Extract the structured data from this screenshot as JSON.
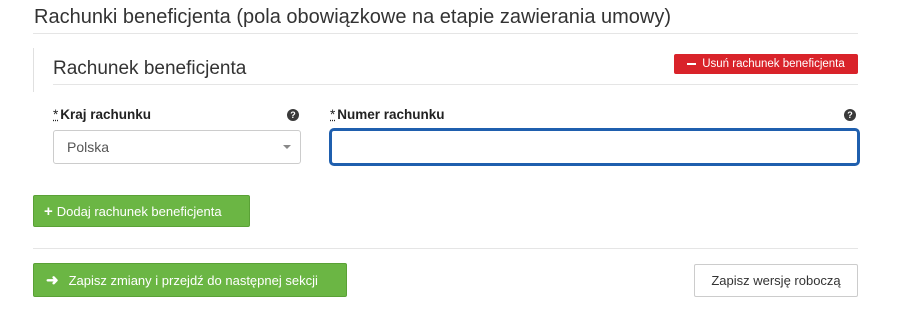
{
  "section": {
    "title": "Rachunki beneficjenta (pola obowiązkowe na etapie zawierania umowy)"
  },
  "account": {
    "title": "Rachunek beneficjenta",
    "remove_label": "Usuń rachunek beneficjenta",
    "country_label": "Kraj rachunku",
    "country_value": "Polska",
    "number_label": "Numer rachunku",
    "number_value": "",
    "required_mark": "*",
    "help_glyph": "?"
  },
  "actions": {
    "add_label": "Dodaj rachunek beneficjenta",
    "save_next_label": "Zapisz zmiany i przejdź do następnej sekcji",
    "draft_label": "Zapisz wersję roboczą"
  },
  "colors": {
    "danger": "#d9232a",
    "success": "#6bb644",
    "focus": "#1f5fae"
  },
  "icons": {
    "remove": "minus-icon",
    "help": "question-circle-icon",
    "dropdown": "caret-down-icon",
    "add": "plus-icon",
    "next": "arrow-right-icon"
  }
}
